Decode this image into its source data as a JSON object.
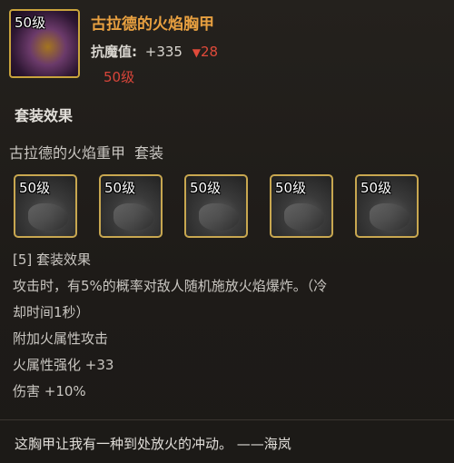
{
  "item": {
    "level_badge": "50级",
    "title": "古拉德的火焰胸甲",
    "stat_label": "抗魔值:",
    "stat_value": "+335",
    "stat_diff_icon": "triangle-down-icon",
    "stat_diff": "28",
    "required_level": "50级"
  },
  "set": {
    "heading": "套装效果",
    "name": "古拉德的火焰重甲",
    "name_suffix": "套装",
    "pieces": [
      {
        "level_badge": "50级",
        "icon": "helmet-icon"
      },
      {
        "level_badge": "50级",
        "icon": "shoulder-armor-icon"
      },
      {
        "level_badge": "50级",
        "icon": "belt-icon"
      },
      {
        "level_badge": "50级",
        "icon": "leg-armor-icon"
      },
      {
        "level_badge": "50级",
        "icon": "boots-icon"
      }
    ],
    "bonus_title": "[5] 套装效果",
    "bonus_lines": [
      "攻击时，有5%的概率对敌人随机施放火焰爆炸。（冷",
      "却时间1秒）",
      "附加火属性攻击",
      "火属性强化 +33",
      "伤害 +10%"
    ]
  },
  "flavor_text": "这胸甲让我有一种到处放火的冲动。 ——海岚",
  "colors": {
    "title": "#e8a040",
    "negative": "#e04a3a",
    "frame": "#c8a750"
  }
}
